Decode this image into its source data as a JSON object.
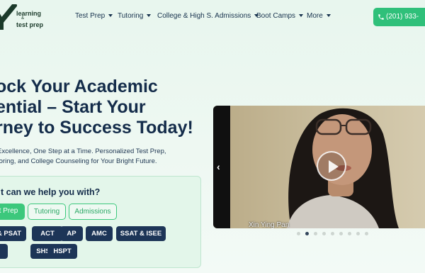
{
  "brand": {
    "name_line1": "learning",
    "name_amp": "&",
    "name_line2": "test prep",
    "mark_color": "#1b3a2a",
    "accent_color": "#3cc87c"
  },
  "nav": {
    "items": [
      {
        "label": "Test Prep",
        "has_dropdown": true
      },
      {
        "label": "Tutoring",
        "has_dropdown": true
      },
      {
        "label": "College & High S. Admissions",
        "has_dropdown": true
      },
      {
        "label": "Boot Camps",
        "has_dropdown": true
      },
      {
        "label": "More",
        "has_dropdown": true
      }
    ],
    "phone": {
      "icon": "phone-icon",
      "label": "(201) 933-"
    }
  },
  "hero": {
    "headline_lines": [
      "ock Your Academic",
      "ential – Start Your",
      "rney to Success Today!"
    ],
    "subtext_lines": [
      "Excellence, One Step at a Time. Personalized Test Prep,",
      "toring, and College Counseling for Your Bright Future."
    ]
  },
  "help": {
    "title": "t can we help you with?",
    "tabs": [
      {
        "label": "t Prep",
        "active": true
      },
      {
        "label": "Tutoring",
        "active": false
      },
      {
        "label": "Admissions",
        "active": false
      }
    ],
    "chips_row1": [
      "& PSAT",
      "ACT",
      "AP",
      "AMC",
      "SSAT & ISEE"
    ],
    "chips_row2": [
      "",
      "SHSAT",
      "HSPT"
    ]
  },
  "video": {
    "caption": "Xin Ying Pan",
    "prev_icon": "chevron-left-icon",
    "play_icon": "play-icon",
    "slide_count": 9,
    "active_slide": 2
  }
}
